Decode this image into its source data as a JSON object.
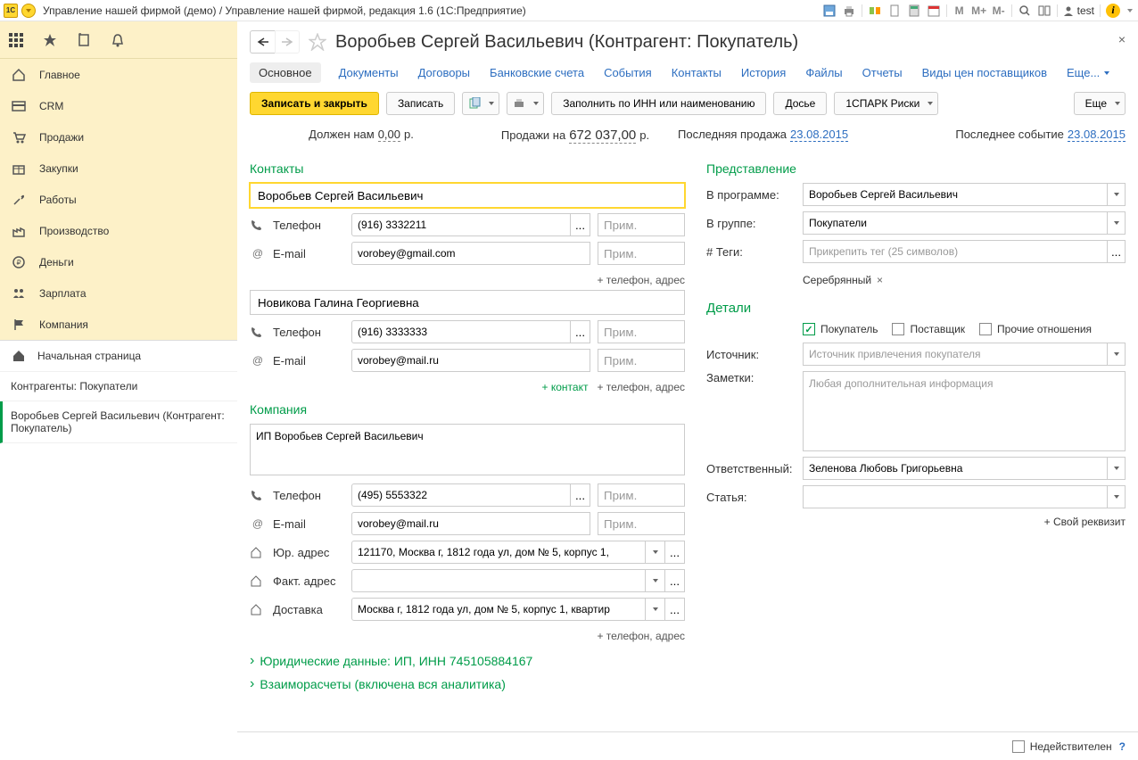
{
  "titlebar": {
    "logo": "1C",
    "title": "Управление нашей фирмой (демо) / Управление нашей фирмой, редакция 1.6  (1С:Предприятие)",
    "user": "test",
    "m_buttons": [
      "M",
      "M+",
      "M-"
    ]
  },
  "sidebar": {
    "items": [
      {
        "label": "Главное",
        "icon": "home"
      },
      {
        "label": "CRM",
        "icon": "card"
      },
      {
        "label": "Продажи",
        "icon": "cart"
      },
      {
        "label": "Закупки",
        "icon": "box"
      },
      {
        "label": "Работы",
        "icon": "tools"
      },
      {
        "label": "Производство",
        "icon": "factory"
      },
      {
        "label": "Деньги",
        "icon": "money"
      },
      {
        "label": "Зарплата",
        "icon": "people"
      },
      {
        "label": "Компания",
        "icon": "flag"
      }
    ],
    "home_page": "Начальная страница",
    "breadcrumb1": "Контрагенты: Покупатели",
    "breadcrumb2": "Воробьев Сергей Васильевич (Контрагент: Покупатель)"
  },
  "header": {
    "title": "Воробьев Сергей Васильевич (Контрагент: Покупатель)"
  },
  "tabs": {
    "main": "Основное",
    "documents": "Документы",
    "contracts": "Договоры",
    "bank": "Банковские счета",
    "events": "События",
    "contacts": "Контакты",
    "history": "История",
    "files": "Файлы",
    "reports": "Отчеты",
    "prices": "Виды цен поставщиков",
    "more": "Еще..."
  },
  "toolbar": {
    "save_close": "Записать и закрыть",
    "save": "Записать",
    "fill_inn": "Заполнить по ИНН или наименованию",
    "dossier": "Досье",
    "spark": "1СПАРК Риски",
    "more": "Еще"
  },
  "stats": {
    "owes_label": "Должен нам",
    "owes_value": "0,00",
    "owes_cur": "р.",
    "sales_label": "Продажи на",
    "sales_value": "672 037,00",
    "sales_cur": "р.",
    "last_sale_label": "Последняя продажа",
    "last_sale_date": "23.08.2015",
    "last_event_label": "Последнее событие",
    "last_event_date": "23.08.2015"
  },
  "contacts": {
    "title": "Контакты",
    "person1": {
      "name": "Воробьев Сергей Васильевич",
      "phone_label": "Телефон",
      "phone": "(916) 3332211",
      "phone_note_ph": "Прим.",
      "email_label": "E-mail",
      "email": "vorobey@gmail.com",
      "email_note_ph": "Прим."
    },
    "add1": "+ телефон, адрес",
    "person2": {
      "name": "Новикова Галина Георгиевна",
      "phone_label": "Телефон",
      "phone": "(916) 3333333",
      "phone_note_ph": "Прим.",
      "email_label": "E-mail",
      "email": "vorobey@mail.ru",
      "email_note_ph": "Прим."
    },
    "add_contact": "+ контакт",
    "add2": "+ телефон, адрес"
  },
  "company": {
    "title": "Компания",
    "name": "ИП Воробьев Сергей Васильевич",
    "phone_label": "Телефон",
    "phone": "(495) 5553322",
    "phone_note_ph": "Прим.",
    "email_label": "E-mail",
    "email": "vorobey@mail.ru",
    "email_note_ph": "Прим.",
    "legal_addr_label": "Юр. адрес",
    "legal_addr": "121170, Москва г, 1812 года ул, дом № 5, корпус 1,",
    "fact_addr_label": "Факт. адрес",
    "fact_addr": "",
    "delivery_label": "Доставка",
    "delivery": "Москва г, 1812 года ул, дом № 5, корпус 1, квартир",
    "add3": "+ телефон, адрес",
    "legal_toggle": "Юридические данные: ИП, ИНН 745105884167",
    "settle_toggle": "Взаиморасчеты (включена вся аналитика)"
  },
  "presentation": {
    "title": "Представление",
    "in_program_label": "В программе:",
    "in_program": "Воробьев Сергей Васильевич",
    "in_group_label": "В группе:",
    "in_group": "Покупатели",
    "tags_label": "# Теги:",
    "tags_ph": "Прикрепить тег (25 символов)",
    "tag1": "Серебрянный"
  },
  "details": {
    "title": "Детали",
    "buyer": "Покупатель",
    "supplier": "Поставщик",
    "other": "Прочие отношения",
    "source_label": "Источник:",
    "source_ph": "Источник привлечения покупателя",
    "notes_label": "Заметки:",
    "notes_ph": "Любая дополнительная информация",
    "responsible_label": "Ответственный:",
    "responsible": "Зеленова Любовь Григорьевна",
    "article_label": "Статья:",
    "add_req": "+ Свой реквизит"
  },
  "footer": {
    "inactive": "Недействителен"
  }
}
